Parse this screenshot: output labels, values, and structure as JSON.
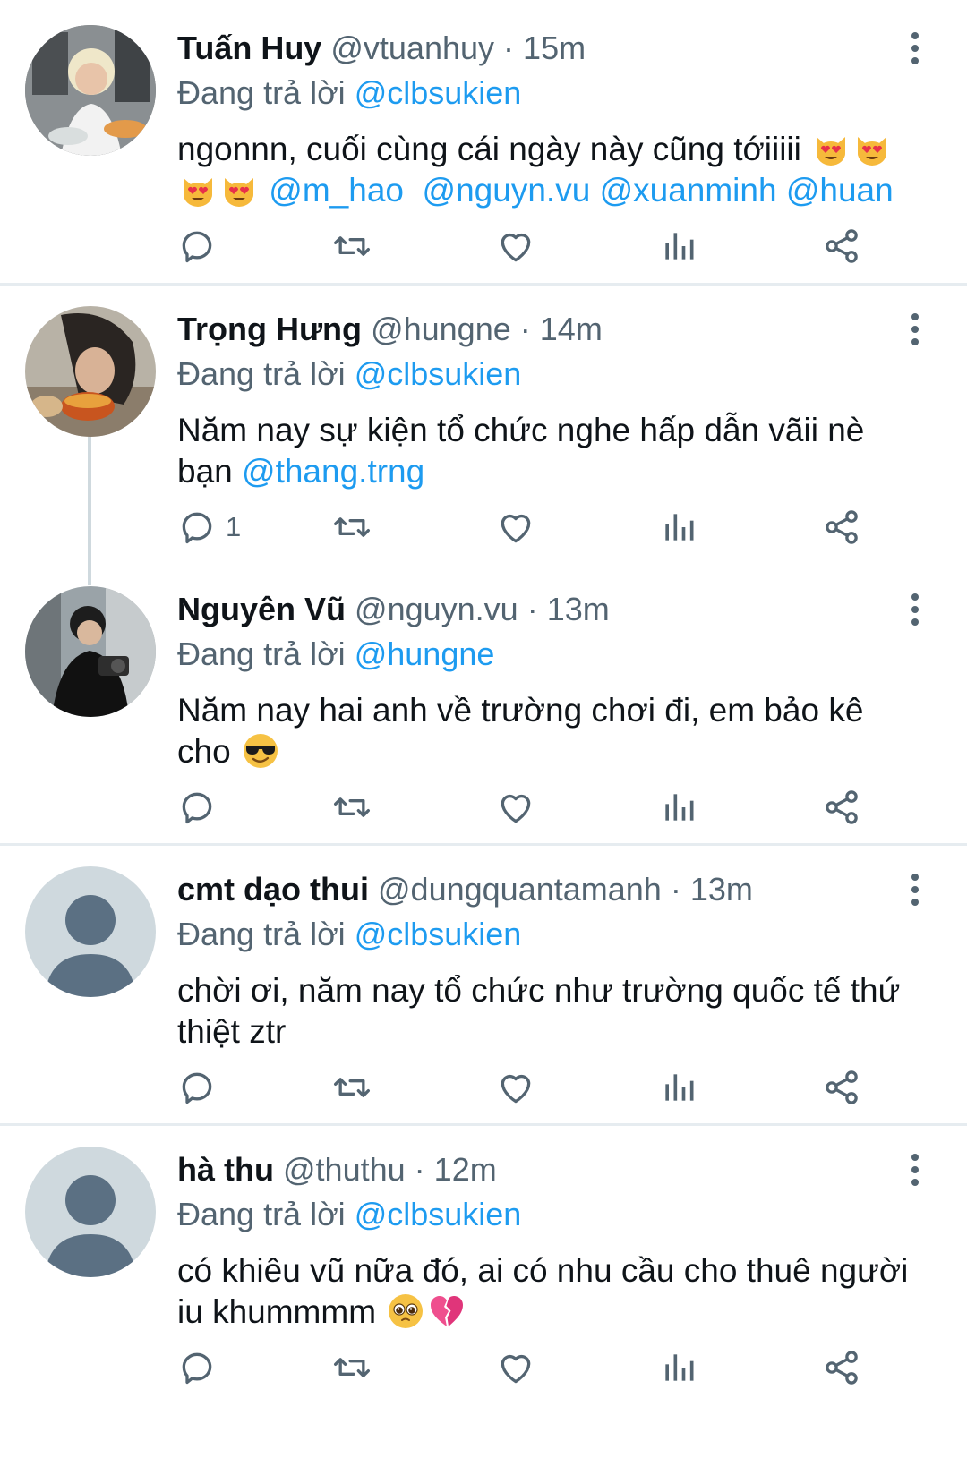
{
  "tweets": [
    {
      "name": "Tuấn Huy",
      "handle": "@vtuanhuy",
      "separator": "·",
      "time": "15m",
      "replying_label": "Đang trả lời",
      "replying_to": "@clbsukien",
      "text_parts": [
        "ngonnn, cuối cùng cái ngày này cũng tớiiiii "
      ],
      "emojis": [
        "heart-eyes-cat",
        "heart-eyes-cat",
        "heart-eyes-cat",
        "heart-eyes-cat"
      ],
      "mentions": [
        "@m_hao",
        "@nguyn.vu",
        "@xuanminh",
        "@huan"
      ],
      "reply_count": "",
      "avatar_icon": "photo-avatar-icon"
    },
    {
      "name": "Trọng Hưng",
      "handle": "@hungne",
      "separator": "·",
      "time": "14m",
      "replying_label": "Đang trả lời",
      "replying_to": "@clbsukien",
      "text_parts": [
        "Năm nay sự kiện tổ chức nghe hấp dẫn vãii nè bạn "
      ],
      "mentions": [
        "@thang.trng"
      ],
      "reply_count": "1",
      "avatar_icon": "photo-avatar-icon"
    },
    {
      "name": "Nguyên Vũ",
      "handle": "@nguyn.vu",
      "separator": "·",
      "time": "13m",
      "replying_label": "Đang trả lời",
      "replying_to": "@hungne",
      "text_parts": [
        "Năm nay hai anh về trường chơi đi, em bảo kê cho "
      ],
      "emojis": [
        "sunglasses-face"
      ],
      "reply_count": "",
      "avatar_icon": "photo-avatar-icon"
    },
    {
      "name": "cmt dạo thui",
      "handle": "@dungquantamanh",
      "separator": "·",
      "time": "13m",
      "replying_label": "Đang trả lời",
      "replying_to": "@clbsukien",
      "text_parts": [
        "chời ơi, năm nay tổ chức như trường quốc tế thứ thiệt ztr"
      ],
      "reply_count": "",
      "avatar_icon": "default-avatar-icon"
    },
    {
      "name": "hà thu",
      "handle": "@thuthu",
      "separator": "·",
      "time": "12m",
      "replying_label": "Đang trả lời",
      "replying_to": "@clbsukien",
      "text_parts": [
        "có khiêu vũ nữa đó, ai có nhu cầu cho thuê người iu khummmm "
      ],
      "emojis": [
        "pleading-face",
        "broken-heart"
      ],
      "reply_count": "",
      "avatar_icon": "default-avatar-icon"
    }
  ],
  "action_icons": [
    "reply-icon",
    "retweet-icon",
    "like-icon",
    "analytics-icon",
    "share-icon"
  ],
  "colors": {
    "text": "#0f1419",
    "secondary": "#536471",
    "mention": "#1d9bf0",
    "divider": "#e6ecf0",
    "default_avatar_bg": "#cfd9de",
    "default_avatar_fg": "#5b7083"
  }
}
